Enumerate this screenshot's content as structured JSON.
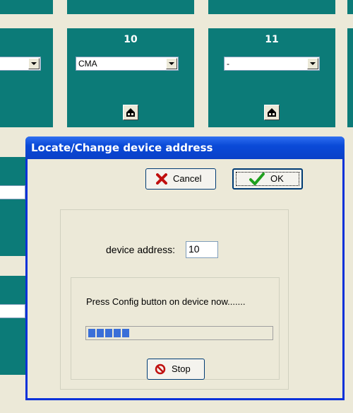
{
  "panels": [
    {
      "title": "",
      "combo_value": ""
    },
    {
      "title": "10",
      "combo_value": "CMA"
    },
    {
      "title": "11",
      "combo_value": "-"
    }
  ],
  "dialog": {
    "title": "Locate/Change device address",
    "cancel_label": "Cancel",
    "ok_label": "OK",
    "address_label": "device address:",
    "address_value": "10",
    "message": "Press Config button on device now.......",
    "progress_blocks": 5,
    "stop_label": "Stop"
  },
  "colors": {
    "panel": "#0c7b78",
    "background": "#ece9d8",
    "titlebar": "#0a4ad8",
    "progress": "#3a6fd8",
    "cancel_icon": "#c01010",
    "ok_icon": "#1fa01f",
    "stop_icon": "#c01010"
  }
}
